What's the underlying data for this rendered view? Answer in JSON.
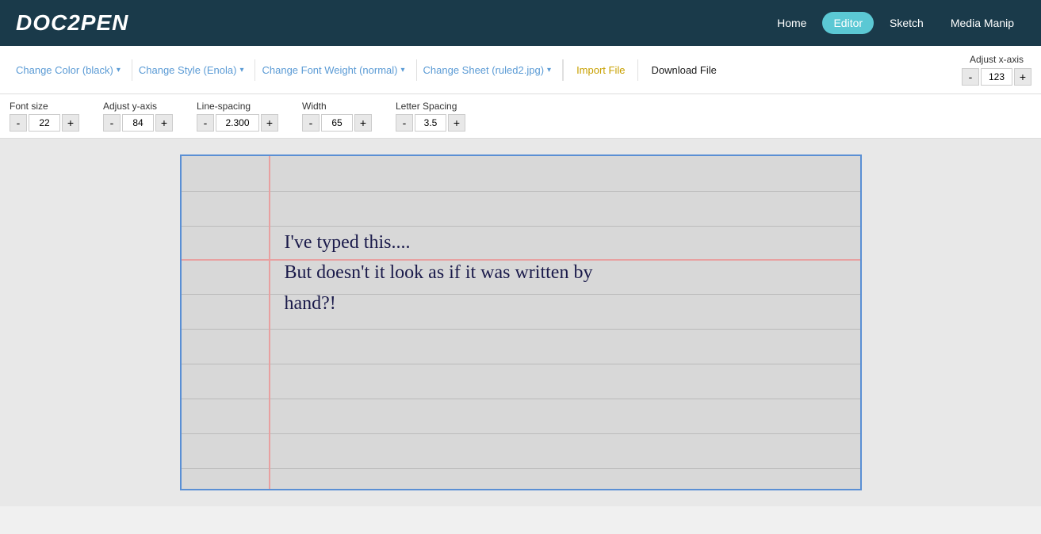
{
  "navbar": {
    "logo": "DOC2PEN",
    "links": [
      {
        "label": "Home",
        "active": false
      },
      {
        "label": "Editor",
        "active": true
      },
      {
        "label": "Sketch",
        "active": false
      },
      {
        "label": "Media Manip",
        "active": false
      }
    ]
  },
  "toolbar1": {
    "change_color": "Change Color (black)",
    "change_style": "Change Style (Enola)",
    "change_weight": "Change Font Weight (normal)",
    "change_sheet": "Change Sheet (ruled2.jpg)",
    "import_file": "Import File",
    "download_file": "Download File",
    "adjust_x_axis_label": "Adjust x-axis",
    "x_axis_value": "123",
    "x_minus": "-",
    "x_plus": "+"
  },
  "toolbar2": {
    "font_size_label": "Font size",
    "font_size_value": "22",
    "font_minus": "-",
    "font_plus": "+",
    "adjust_y_label": "Adjust y-axis",
    "y_value": "84",
    "y_minus": "-",
    "y_plus": "+",
    "line_spacing_label": "Line-spacing",
    "line_spacing_value": "2.300",
    "ls_minus": "-",
    "ls_plus": "+",
    "width_label": "Width",
    "width_value": "65",
    "w_minus": "-",
    "w_plus": "+",
    "letter_spacing_label": "Letter Spacing",
    "letter_spacing_value": "3.5",
    "lsp_minus": "-",
    "lsp_plus": "+"
  },
  "canvas": {
    "line1": "I've typed this....",
    "line2": "But doesn't it look as if it was written by",
    "line3": "hand?!"
  }
}
